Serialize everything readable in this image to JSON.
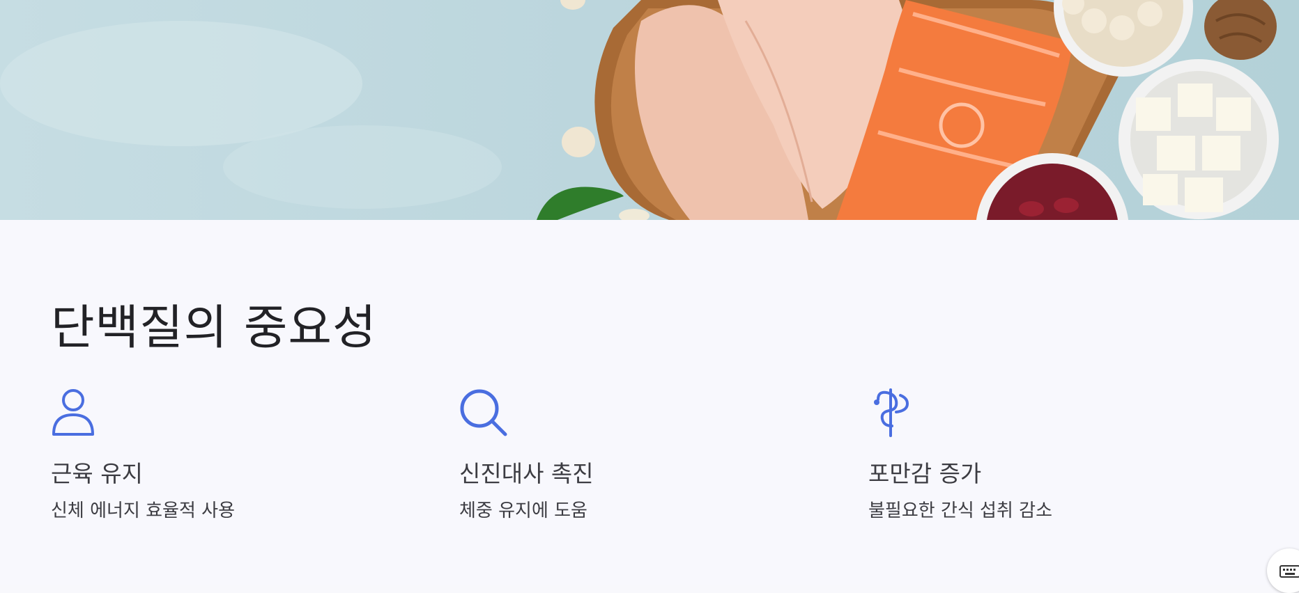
{
  "section": {
    "title": "단백질의 중요성"
  },
  "features": [
    {
      "icon": "person-icon",
      "title": "근육 유지",
      "description": "신체 에너지 효율적 사용"
    },
    {
      "icon": "magnifier-icon",
      "title": "신진대사 촉진",
      "description": "체중 유지에 도움"
    },
    {
      "icon": "caduceus-icon",
      "title": "포만감 증가",
      "description": "불필요한 간식 섭취 감소"
    }
  ],
  "colors": {
    "accent": "#4a6ee0",
    "text": "#3c3c42",
    "title": "#222226",
    "background": "#f8f8fd"
  }
}
